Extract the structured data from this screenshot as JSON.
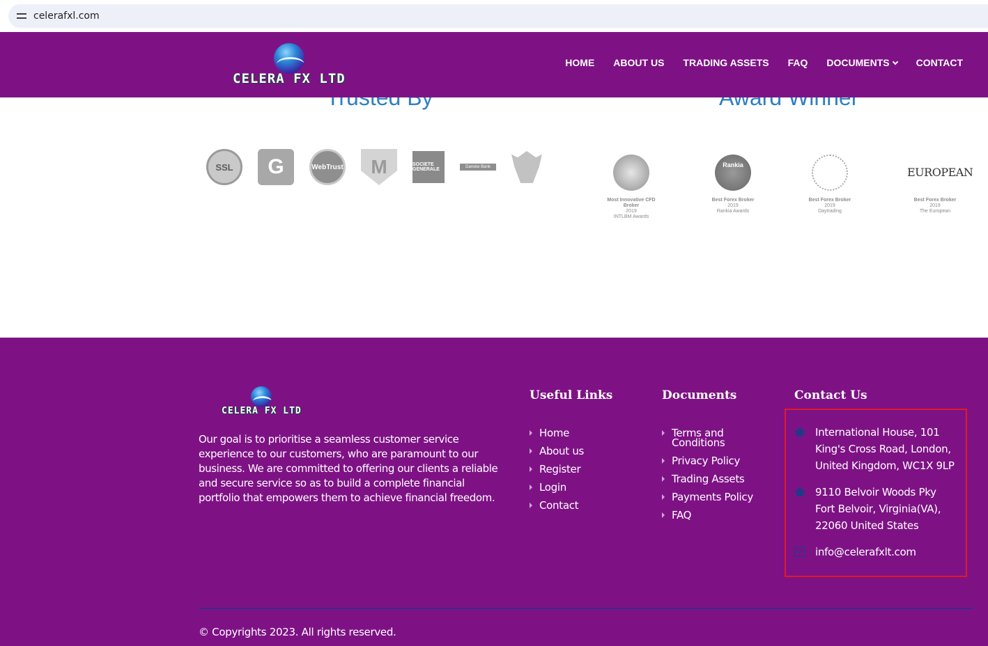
{
  "browser": {
    "url": "celerafxl.com"
  },
  "header": {
    "logo_text": "CELERA FX LTD",
    "nav": [
      {
        "label": "HOME"
      },
      {
        "label": "ABOUT US"
      },
      {
        "label": "TRADING ASSETS"
      },
      {
        "label": "FAQ"
      },
      {
        "label": "DOCUMENTS"
      },
      {
        "label": "CONTACT"
      }
    ]
  },
  "trusted": {
    "title": "Trusted By",
    "logos": [
      {
        "icon": "ssl-badge-icon",
        "text": "SSL"
      },
      {
        "icon": "g-logo-icon",
        "text": "G"
      },
      {
        "icon": "webtrust-icon",
        "text": "WebTrust"
      },
      {
        "icon": "mcafee-shield-icon",
        "text": "M"
      },
      {
        "icon": "societe-generale-icon",
        "text": "SOCIETE GENERALE"
      },
      {
        "icon": "danske-bank-icon",
        "text": "Danske Bank"
      },
      {
        "icon": "eagle-logo-icon",
        "text": ""
      }
    ]
  },
  "awards": {
    "title": "Award Winner",
    "items": [
      {
        "icon": "medal-icon",
        "name": "Most Innovative CFD Broker",
        "year": "2019",
        "source": "INTLBM Awards"
      },
      {
        "icon": "rankia-medal-icon",
        "name": "Best Forex Broker",
        "year": "2019",
        "source": "Rankia Awards",
        "badge_text": "Rankia"
      },
      {
        "icon": "laurel-icon",
        "name": "Best Forex Broker",
        "year": "2019",
        "source": "Daytrading"
      },
      {
        "icon": "european-logo-icon",
        "name": "Best Forex Broker",
        "year": "2019",
        "source": "The European",
        "logo_text": "EUROPEAN"
      }
    ]
  },
  "footer": {
    "logo_text": "CELERA FX LTD",
    "about": "Our goal is to prioritise a seamless customer service experience to our customers, who are paramount to our business. We are committed to offering our clients a reliable and secure service so as to build a complete financial portfolio that empowers them to achieve financial freedom.",
    "useful_links": {
      "title": "Useful Links",
      "items": [
        "Home",
        "About us",
        "Register",
        "Login",
        "Contact"
      ]
    },
    "documents": {
      "title": "Documents",
      "items": [
        "Terms and Conditions",
        "Privacy Policy",
        "Trading Assets",
        "Payments Policy",
        "FAQ"
      ]
    },
    "contact": {
      "title": "Contact Us",
      "address1": "International House, 101 King's Cross Road, London, United Kingdom, WC1X 9LP",
      "address2": "9110 Belvoir Woods Pky Fort Belvoir, Virginia(VA), 22060 United States",
      "email": "info@celerafxlt.com"
    },
    "copyright": "© Copyrights 2023. All rights reserved."
  }
}
